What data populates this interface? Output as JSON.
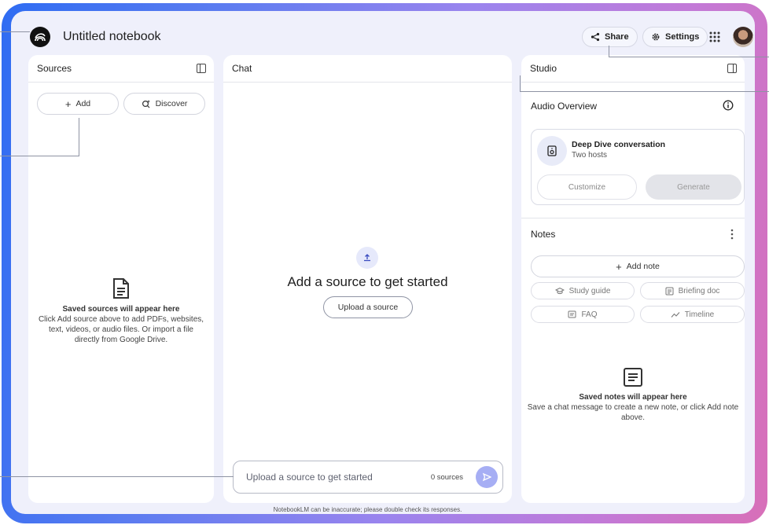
{
  "header": {
    "notebook_title": "Untitled notebook",
    "share_label": "Share",
    "settings_label": "Settings"
  },
  "sources": {
    "title": "Sources",
    "add_label": "Add",
    "discover_label": "Discover",
    "empty_heading": "Saved sources will appear here",
    "empty_body": "Click Add source above to add PDFs, websites, text, videos, or audio files. Or import a file directly from Google Drive."
  },
  "chat": {
    "title": "Chat",
    "headline": "Add a source to get started",
    "upload_label": "Upload a source",
    "input_placeholder": "Upload a source to get started",
    "source_count": "0 sources",
    "disclaimer": "NotebookLM can be inaccurate; please double check its responses."
  },
  "studio": {
    "title": "Studio",
    "audio_overview_title": "Audio Overview",
    "audio_card_title": "Deep Dive conversation",
    "audio_card_subtitle": "Two hosts",
    "customize_label": "Customize",
    "generate_label": "Generate",
    "notes_title": "Notes",
    "add_note_label": "Add note",
    "study_guide_label": "Study guide",
    "briefing_doc_label": "Briefing doc",
    "faq_label": "FAQ",
    "timeline_label": "Timeline",
    "notes_empty_heading": "Saved notes will appear here",
    "notes_empty_body": "Save a chat message to create a new note, or click Add note above."
  },
  "colors": {
    "accent": "#a6aef4",
    "app_background": "#eff0fb",
    "frame_gradient_start": "#2f6cf2",
    "frame_gradient_end": "#d86fb8"
  },
  "icons": [
    "logo-icon",
    "share-icon",
    "gear-icon",
    "apps-grid-icon",
    "panel-toggle-icon",
    "plus-icon",
    "discover-icon",
    "document-icon",
    "upload-icon",
    "send-icon",
    "info-icon",
    "speaker-icon",
    "kebab-icon",
    "study-guide-icon",
    "briefing-doc-icon",
    "faq-icon",
    "timeline-icon",
    "notes-icon"
  ]
}
